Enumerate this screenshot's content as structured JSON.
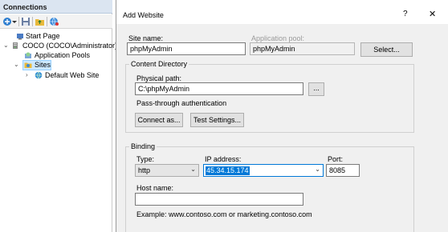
{
  "connections": {
    "title": "Connections",
    "toolbar_icons": [
      "connect-icon",
      "dropdown-arrow-icon",
      "save-icon",
      "folder-up-icon",
      "globe-connection-icon"
    ],
    "tree": {
      "start_page": "Start Page",
      "server": "COCO (COCO\\Administrator)",
      "app_pools": "Application Pools",
      "sites": "Sites",
      "default_site": "Default Web Site"
    }
  },
  "dialog": {
    "title": "Add Website",
    "help": "?",
    "close": "✕",
    "site_name": {
      "label": "Site name:",
      "value": "phpMyAdmin"
    },
    "app_pool": {
      "label": "Application pool:",
      "value": "phpMyAdmin"
    },
    "select_button": "Select...",
    "content_directory": {
      "title": "Content Directory",
      "physical_path_label": "Physical path:",
      "physical_path_value": "C:\\phpMyAdmin",
      "browse_button": "...",
      "passthrough_label": "Pass-through authentication",
      "connect_as_button": "Connect as...",
      "test_settings_button": "Test Settings..."
    },
    "binding": {
      "title": "Binding",
      "type_label": "Type:",
      "type_value": "http",
      "ip_label": "IP address:",
      "ip_value": "45.34.15.174",
      "port_label": "Port:",
      "port_value": "8085",
      "host_label": "Host name:",
      "host_value": "",
      "example_text": "Example: www.contoso.com or marketing.contoso.com"
    }
  }
}
